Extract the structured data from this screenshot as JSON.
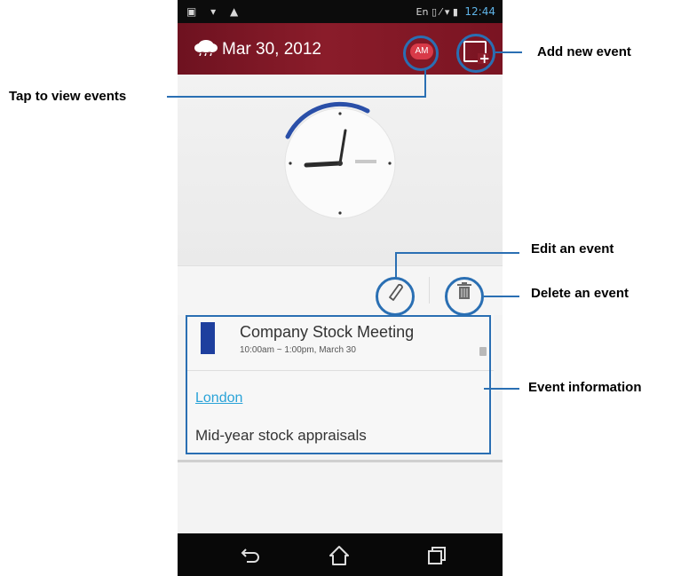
{
  "status_bar": {
    "left_icons": "▣ ▾ ▲",
    "right_icons": "En ▯ ⁄ ▾ ▮",
    "time": "12:44"
  },
  "app_bar": {
    "date": "Mar 30, 2012",
    "ampm_label": "AM"
  },
  "event": {
    "title": "Company Stock Meeting",
    "time": "10:00am ~ 1:00pm, March 30",
    "location": "London",
    "description": "Mid-year stock appraisals",
    "color": "#1e3f9e"
  },
  "callouts": {
    "add_new_event": "Add new event",
    "tap_to_view_events": "Tap to view events",
    "edit_an_event": "Edit an event",
    "delete_an_event": "Delete an event",
    "event_information": "Event information"
  },
  "colors": {
    "accent": "#2a6fb3",
    "app_bar": "#8a1c2a",
    "ampm_badge": "#d83a48",
    "link": "#2aa3d8"
  },
  "icons": {
    "weather": "cloud-icon",
    "add_event": "add-event-icon",
    "edit": "pencil-icon",
    "delete": "trash-icon",
    "back": "back-icon",
    "home": "home-icon",
    "recents": "recents-icon"
  }
}
